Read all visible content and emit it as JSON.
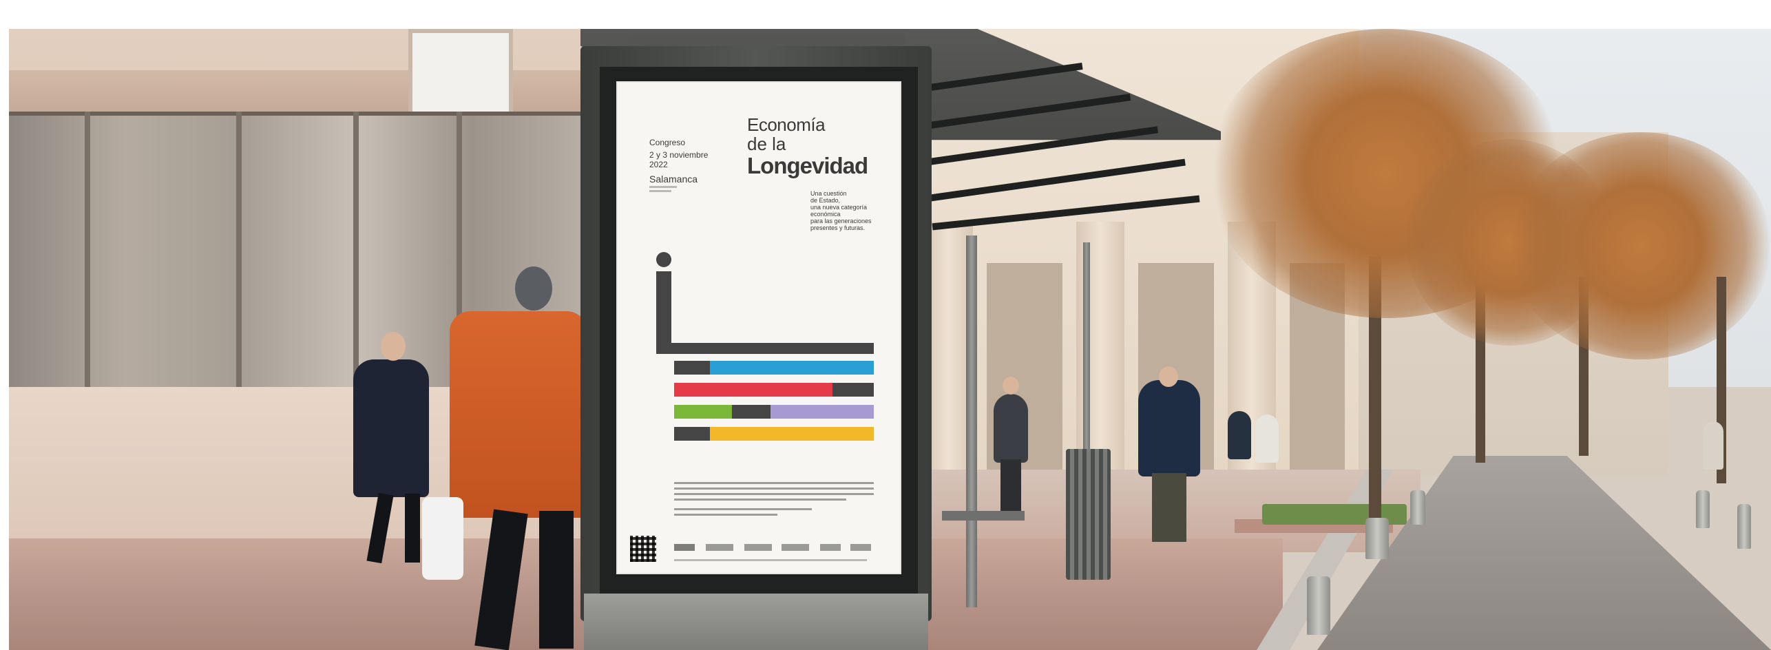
{
  "scene": "bus stop advertising poster on a city street",
  "poster": {
    "congress_label": "Congreso",
    "dates_line1": "2 y 3 noviembre",
    "dates_line2": "2022",
    "city": "Salamanca",
    "title_line1": "Economía",
    "title_line2": "de la",
    "title_line3": "Longevidad",
    "subtitle_line1": "Una cuestión",
    "subtitle_line2": "de Estado,",
    "subtitle_line3": "una nueva categoría",
    "subtitle_line4": "económica",
    "subtitle_line5": "para las generaciones",
    "subtitle_line6": "presentes y futuras."
  },
  "colors": {
    "poster_bg": "#f7f6f2",
    "text_dark": "#3a3a3a",
    "bar_gray": "#454545",
    "bar_blue": "#2a9fd6",
    "bar_red": "#e43a4a",
    "bar_green": "#7bb83a",
    "bar_purple": "#a79ad2",
    "bar_yellow": "#f2b82a"
  }
}
